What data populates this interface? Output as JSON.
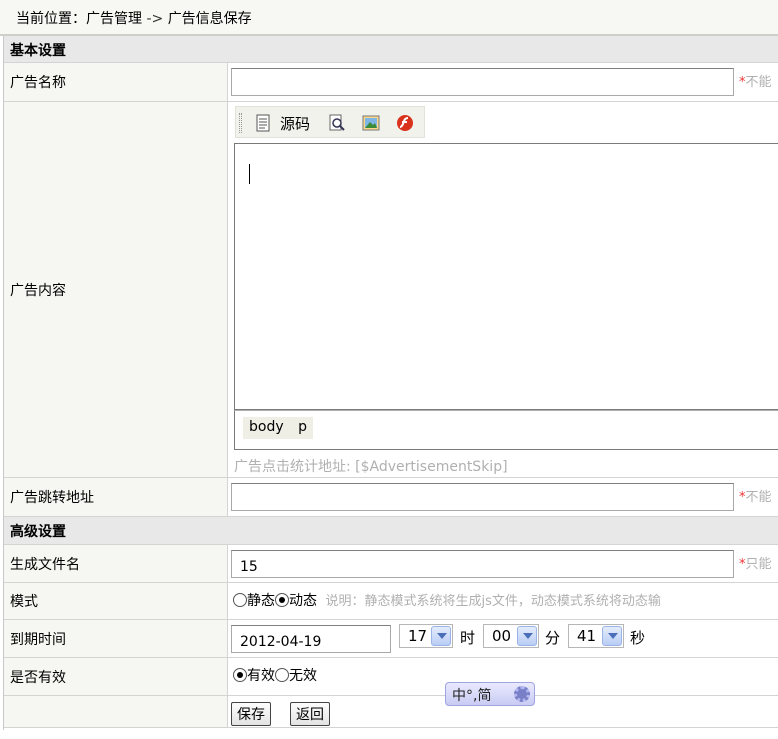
{
  "breadcrumb": {
    "prefix": "当前位置：广告管理",
    "arrow": " -> ",
    "current": "广告信息保存"
  },
  "sections": {
    "basic": "基本设置",
    "advanced": "高级设置"
  },
  "fields": {
    "ad_name": {
      "label": "广告名称",
      "value": "",
      "hint_star": "*",
      "hint": "不能"
    },
    "ad_content": {
      "label": "广告内容",
      "toolbar": {
        "source_label": "源码"
      },
      "path": "body p",
      "note": "广告点击统计地址: [$AdvertisementSkip]"
    },
    "ad_url": {
      "label": "广告跳转地址",
      "value": "",
      "hint_star": "*",
      "hint": "不能"
    },
    "filename": {
      "label": "生成文件名",
      "value": "15",
      "hint_star": "*",
      "hint": "只能"
    },
    "mode": {
      "label": "模式",
      "options": [
        "静态",
        "动态"
      ],
      "selected": "动态",
      "note": "说明：静态模式系统将生成js文件，动态模式系统将动态输"
    },
    "expire": {
      "label": "到期时间",
      "date": "2012-04-19",
      "hour": "17",
      "hour_unit": "时",
      "minute": "00",
      "minute_unit": "分",
      "second": "41",
      "second_unit": "秒"
    },
    "valid": {
      "label": "是否有效",
      "options": [
        "有效",
        "无效"
      ],
      "selected": "有效"
    }
  },
  "buttons": {
    "save": "保存",
    "back": "返回"
  },
  "ime": {
    "text": "中°,简"
  },
  "colors": {
    "required_star": "#e33",
    "hint_gray": "#b0b0b0",
    "label_bg": "#f6f6f2",
    "section_bg": "#e8e8e8"
  }
}
